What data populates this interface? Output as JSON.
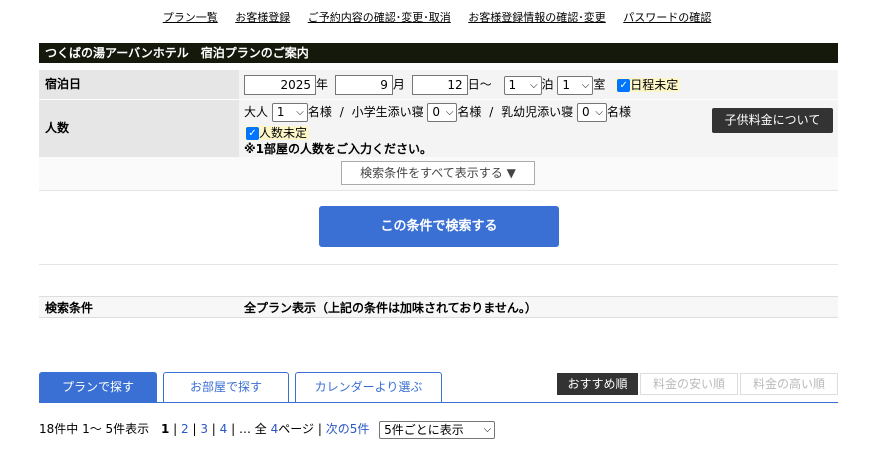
{
  "topnav": [
    "プラン一覧",
    "お客様登録",
    "ご予約内容の確認･変更･取消",
    "お客様登録情報の確認･変更",
    "パスワードの確認"
  ],
  "title": "つくばの湯アーバンホテル　宿泊プランのご案内",
  "stay": {
    "label": "宿泊日",
    "year": "2025",
    "year_unit": "年",
    "month": "9",
    "month_unit": "月",
    "day": "12",
    "day_unit": "日～",
    "nights": "1",
    "nights_unit": "泊",
    "rooms": "1",
    "rooms_unit": "室",
    "undecided_label": "日程未定"
  },
  "people": {
    "label": "人数",
    "adult_label": "大人",
    "adult_value": "1",
    "adult_unit": "名様",
    "sep": "/",
    "child_label": "小学生添い寝",
    "child_value": "0",
    "child_unit": "名様",
    "infant_label": "乳幼児添い寝",
    "infant_value": "0",
    "infant_unit": "名様",
    "undecided_label": "人数未定",
    "note": "※1部屋の人数をご入力ください。",
    "child_fee_button": "子供料金について"
  },
  "show_all_button": "検索条件をすべて表示する ▼",
  "search_button": "この条件で検索する",
  "conditions": {
    "label": "検索条件",
    "value": "全プラン表示（上記の条件は加味されておりません。）"
  },
  "tabs": [
    "プランで探す",
    "お部屋で探す",
    "カレンダーより選ぶ"
  ],
  "sort": [
    "おすすめ順",
    "料金の安い順",
    "料金の高い順"
  ],
  "pager": {
    "summary": "18件中 1～ 5件表示",
    "current": "1",
    "pages": [
      "2",
      "3",
      "4"
    ],
    "ellipsis": "… 全",
    "total": "4",
    "total_unit": "ページ",
    "next": "次の5件",
    "per_page": "5件ごとに表示"
  }
}
